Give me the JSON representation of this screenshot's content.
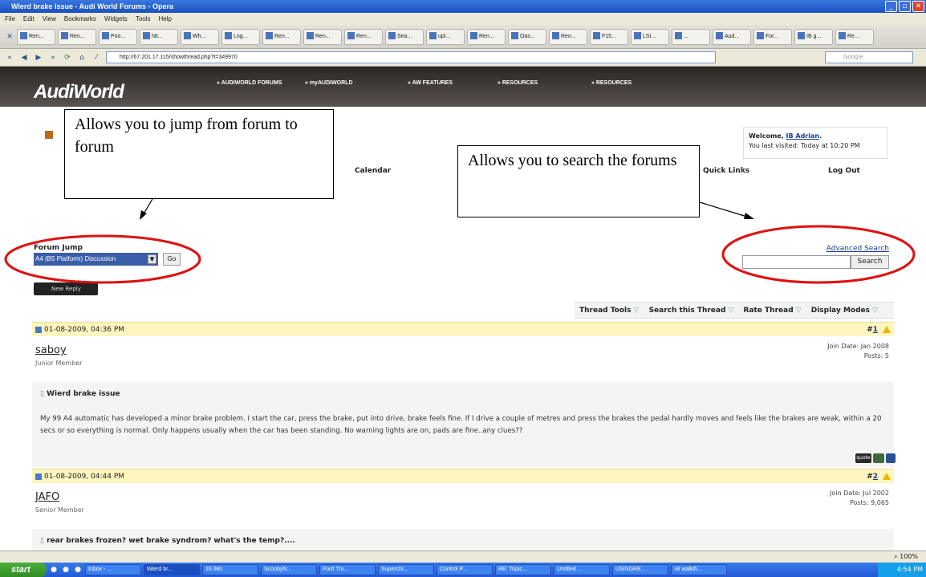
{
  "window": {
    "title": "Wierd brake issue - Audi World Forums - Opera"
  },
  "menu": [
    "File",
    "Edit",
    "View",
    "Bookmarks",
    "Widgets",
    "Tools",
    "Help"
  ],
  "tabs": [
    "Ren...",
    "Ren...",
    "Poo...",
    "htt...",
    "Wh...",
    "Log...",
    "Ren...",
    "Ren...",
    "Ren...",
    "Sea...",
    "upl...",
    "Ren...",
    "Oas...",
    "Ren...",
    "F15...",
    "LSI...",
    "...",
    "Aud...",
    "For...",
    "IB g...",
    "Re..."
  ],
  "address": {
    "url": "http://67.201.17.115/showthread.php?t=349970",
    "search_placeholder": "Google"
  },
  "site": {
    "logo": "AudiWorld",
    "nav": [
      "» AUDIWORLD FORUMS",
      "» myAUDIWORLD",
      "» AW FEATURES",
      "» RESOURCES",
      "» RESOURCES"
    ],
    "welcome_prefix": "Welcome, ",
    "welcome_user": "IB Adrian",
    "welcome_suffix": ".",
    "last_visited": "You last visited: Today at 10:20 PM",
    "navstrip": {
      "calendar": "Calendar",
      "quick_links": "Quick Links",
      "log_out": "Log Out"
    }
  },
  "forum_jump": {
    "label": "Forum Jump",
    "selected": "A4 (B5 Platform) Discussion",
    "go": "Go"
  },
  "search": {
    "advanced": "Advanced Search",
    "button": "Search"
  },
  "new_reply": "New Reply",
  "thread_tools": [
    "Thread Tools",
    "Search this Thread",
    "Rate Thread",
    "Display Modes"
  ],
  "posts": [
    {
      "date": "01-08-2009, 04:36 PM",
      "num": "1",
      "user": "saboy",
      "rank": "Junior Member",
      "join": "Join Date: Jan 2008",
      "posts": "Posts: 5",
      "title": "Wierd brake issue",
      "body": "My 99 A4 automatic has developed a minor brake problem. I start the car, press the brake, put into drive, brake feels fine. If I drive a couple of metres and press the brakes the pedal hardly moves and feels like the brakes are weak, within a 20 secs or so everything is normal. Only happens usually when the car has been standing. No warning lights are on, pads are fine..any clues??",
      "quote": "quote"
    },
    {
      "date": "01-08-2009, 04:44 PM",
      "num": "2",
      "user": "JAFO",
      "rank": "Senior Member",
      "join": "Join Date: Jul 2002",
      "posts": "Posts: 9,065",
      "title": "rear brakes frozen? wet brake syndrom? what's the temp?...."
    }
  ],
  "annotations": {
    "left": "Allows you to jump from forum to forum",
    "right": "Allows you to search the forums"
  },
  "status": {
    "zoom": "100%"
  },
  "taskbar": {
    "start": "start",
    "items": [
      "Inbox - ...",
      "Wierd br...",
      "16 IMs",
      "ScoobyN...",
      "Ford Tru...",
      "Superchi...",
      "Control P...",
      "RE: Topic...",
      "Untitled ...",
      "USINGRE...",
      "v8 walkth..."
    ],
    "time": "4:54 PM"
  }
}
